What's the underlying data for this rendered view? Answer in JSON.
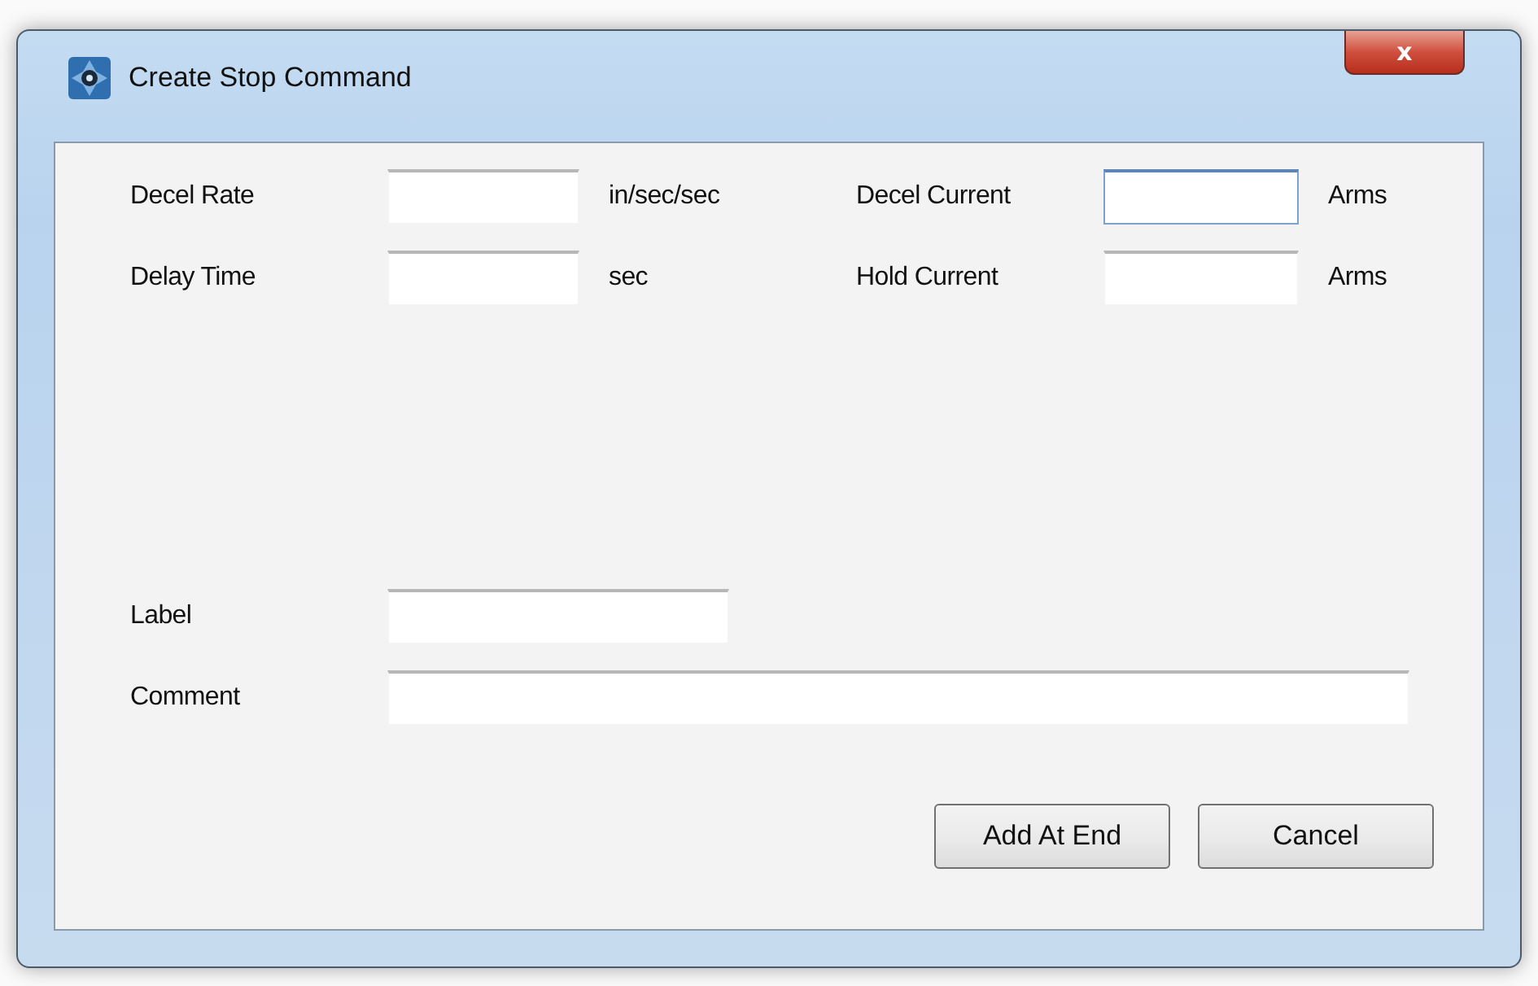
{
  "window": {
    "title": "Create Stop Command",
    "close_label": "x"
  },
  "fields": [
    {
      "label": "Decel Rate",
      "unit": "in/sec/sec",
      "focused": false
    },
    {
      "label": "Decel Current",
      "unit": "Arms",
      "focused": true
    },
    {
      "label": "Delay Time",
      "unit": "sec",
      "focused": false
    },
    {
      "label": "Hold Current",
      "unit": "Arms",
      "focused": false
    }
  ],
  "label_field": {
    "label": "Label"
  },
  "comment_field": {
    "label": "Comment"
  },
  "buttons": [
    "Add At End",
    "Cancel"
  ]
}
